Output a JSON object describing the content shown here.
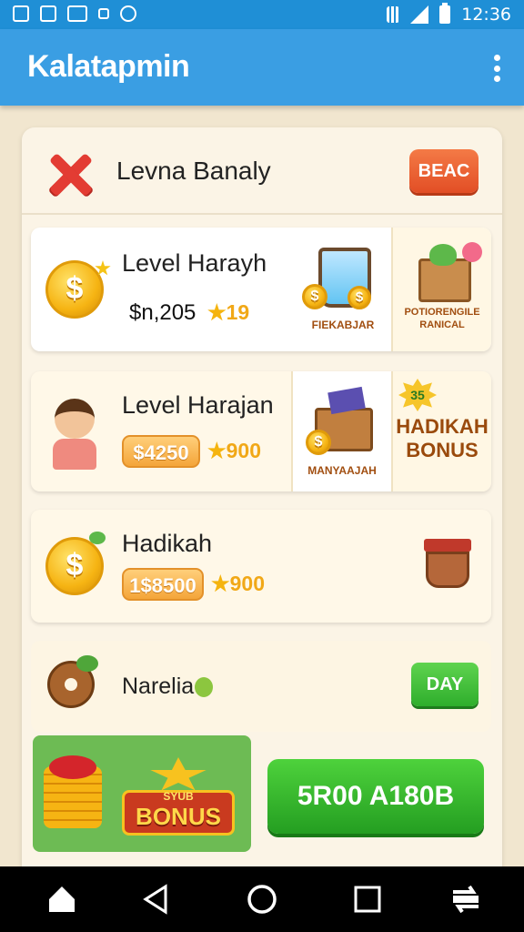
{
  "status_bar": {
    "time": "12:36"
  },
  "app_bar": {
    "title": "Kalatapmin"
  },
  "panel": {
    "header_title": "Levna Banaly",
    "header_button": "BEAC"
  },
  "rows": [
    {
      "title": "Level Harayh",
      "price": "$n,205",
      "stars": "19",
      "tile1_label": "FIEKABJAR",
      "tile2_label": "POTIORENGILE RANICAL"
    },
    {
      "title": "Level Harajan",
      "price": "$4250",
      "stars": "900",
      "tile1_label": "MANYAAJAH",
      "tile2_badge": "35",
      "tile2_label": "HADIKAH BONUS"
    },
    {
      "title": "Hadikah",
      "price": "1$8500",
      "stars": "900"
    },
    {
      "title": "Narelia",
      "button": "DAY"
    }
  ],
  "promo": {
    "badge_top": "SYUB",
    "badge_main": "BONUS",
    "cta": "5R00 A180B"
  },
  "coin_symbol": "$",
  "icons": [
    "close-icon",
    "coin-icon",
    "star-icon",
    "menu-dots-icon",
    "back-icon",
    "home-icon",
    "recents-icon"
  ],
  "colors": {
    "app_bar": "#3a9ee3",
    "status_bar": "#1f8fd6",
    "cta_green": "#2fae2c",
    "accent_orange": "#e24e25"
  }
}
